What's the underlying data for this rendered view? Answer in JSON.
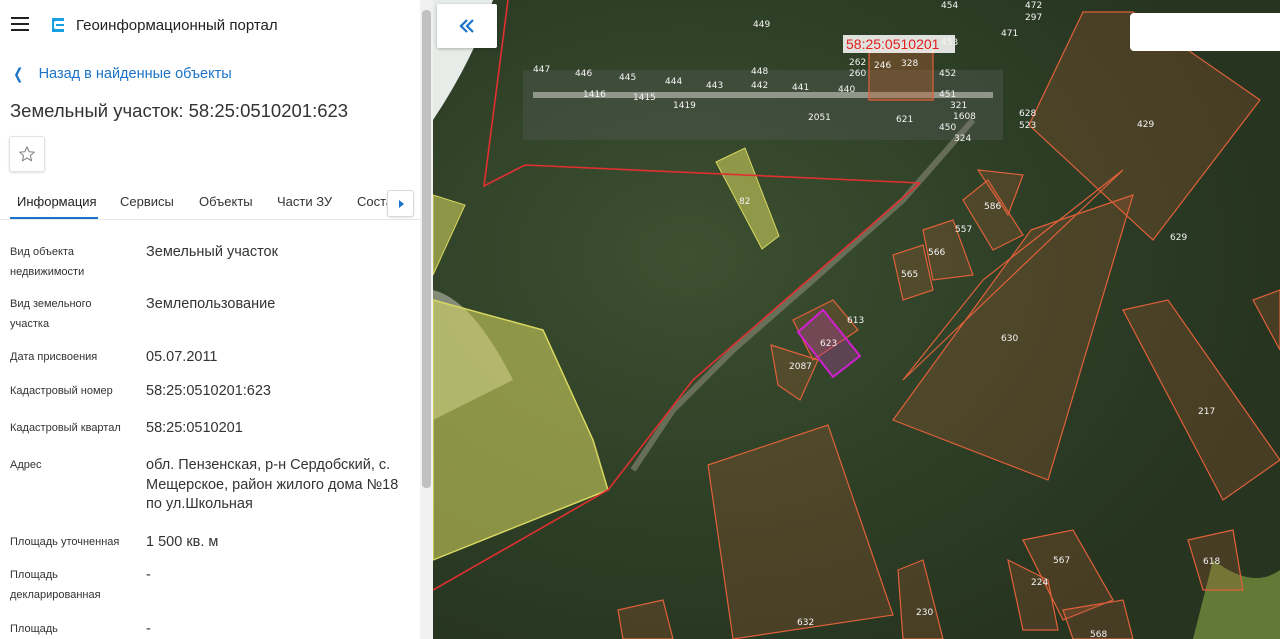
{
  "app": {
    "title": "Геоинформационный портал",
    "menu_icon": "hamburger-icon",
    "logo_icon": "portal-logo-icon"
  },
  "nav": {
    "back_label": "Назад в найденные объекты"
  },
  "object": {
    "title": "Земельный участок: 58:25:0510201:623"
  },
  "tabs": [
    {
      "label": "Информация",
      "active": true
    },
    {
      "label": "Сервисы",
      "active": false
    },
    {
      "label": "Объекты",
      "active": false
    },
    {
      "label": "Части ЗУ",
      "active": false
    },
    {
      "label": "Соста",
      "active": false
    }
  ],
  "info": [
    {
      "label": "Вид объекта недвижимости",
      "value": "Земельный участок"
    },
    {
      "label": "Вид земельного участка",
      "value": "Землепользование"
    },
    {
      "label": "Дата присвоения",
      "value": "05.07.2011"
    },
    {
      "label": "Кадастровый номер",
      "value": "58:25:0510201:623"
    },
    {
      "label": "Кадастровый квартал",
      "value": "58:25:0510201"
    },
    {
      "label": "Адрес",
      "value": "обл. Пензенская, р-н Сердобский, с. Мещерское, район жилого дома №18 по ул.Школьная"
    },
    {
      "label": "Площадь уточненная",
      "value": "1 500 кв. м"
    },
    {
      "label": "Площадь декларированная",
      "value": "-"
    },
    {
      "label": "Площадь",
      "value": "-"
    }
  ],
  "map": {
    "quarter_label": "58:25:0510201",
    "search_value": "",
    "parcel_labels": [
      "449",
      "454",
      "472",
      "297",
      "471",
      "447",
      "446",
      "445",
      "444",
      "443",
      "448",
      "442",
      "441",
      "440",
      "262",
      "260",
      "246",
      "328",
      "453",
      "452",
      "451",
      "321",
      "1608",
      "450",
      "324",
      "1416",
      "1415",
      "1419",
      "2051",
      "621",
      "628",
      "523",
      "429",
      "629",
      "82",
      "586",
      "557",
      "566",
      "565",
      "613",
      "623",
      "2087",
      "630",
      "217",
      "567",
      "224",
      "618",
      "230",
      "632",
      "568"
    ],
    "colors": {
      "quarter_border": "#e03030",
      "parcel_border": "#e0603a",
      "selected_border": "#d020d0",
      "highlight_fill": "#d8d860"
    }
  },
  "colors": {
    "accent": "#1a73c8",
    "text": "#333333"
  }
}
